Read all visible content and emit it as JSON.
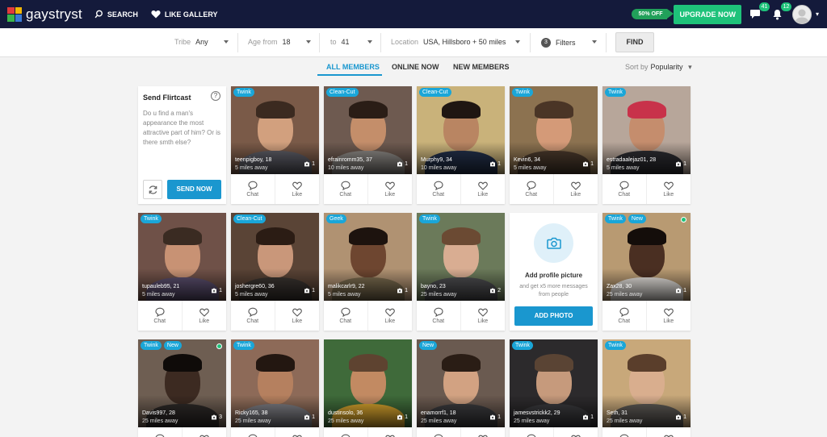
{
  "header": {
    "brand": "gaystryst",
    "nav": [
      {
        "label": "SEARCH",
        "icon": "search-icon"
      },
      {
        "label": "LIKE GALLERY",
        "icon": "heart-icon"
      }
    ],
    "discount": "50% OFF",
    "upgrade": "UPGRADE NOW",
    "messages_count": "41",
    "notifications_count": "12"
  },
  "filters": {
    "tribe_label": "Tribe",
    "tribe_value": "Any",
    "age_from_label": "Age from",
    "age_from_value": "18",
    "age_to_label": "to",
    "age_to_value": "41",
    "location_label": "Location",
    "location_value": "USA, Hillsboro + 50 miles",
    "filters_count": "3",
    "filters_label": "Filters",
    "find": "FIND"
  },
  "tabs": [
    {
      "label": "ALL MEMBERS",
      "active": true
    },
    {
      "label": "ONLINE NOW",
      "active": false
    },
    {
      "label": "NEW MEMBERS",
      "active": false
    }
  ],
  "sort": {
    "label": "Sort by",
    "value": "Popularity"
  },
  "flirtcast": {
    "title": "Send Flirtcast",
    "text": "Do u find a man's appearance the most attractive part of him? Or is there smth else?",
    "send": "SEND NOW",
    "help": "?"
  },
  "actions": {
    "chat": "Chat",
    "like": "Like"
  },
  "add_photo": {
    "title": "Add profile picture",
    "subtitle": "and get x5 more messages from people",
    "button": "ADD PHOTO"
  },
  "members": [
    {
      "name": "teenpigboy, 18",
      "distance": "5 miles away",
      "photos": "1",
      "badges": [
        "Twink"
      ],
      "online": false,
      "bg": "#7a5a48",
      "skin": "#d2a07e",
      "hair": "#3b2a20",
      "shirt": "#5d5d66"
    },
    {
      "name": "efrainromm35, 37",
      "distance": "10 miles away",
      "photos": "1",
      "badges": [
        "Clean-Cut"
      ],
      "online": false,
      "bg": "#6e5a50",
      "skin": "#c48e6a",
      "hair": "#2a1d16",
      "shirt": "#8e8a86"
    },
    {
      "name": "Murphy9, 34",
      "distance": "10 miles away",
      "photos": "1",
      "badges": [
        "Clean-Cut"
      ],
      "online": false,
      "bg": "#c9b27a",
      "skin": "#b98562",
      "hair": "#1f1612",
      "shirt": "#23304a"
    },
    {
      "name": "Kevin6, 34",
      "distance": "5 miles away",
      "photos": "1",
      "badges": [
        "Twink"
      ],
      "online": false,
      "bg": "#8c7250",
      "skin": "#d49a78",
      "hair": "#4a3526",
      "shirt": "#4b3a2c"
    },
    {
      "name": "estradaalejaz01, 28",
      "distance": "5 miles away",
      "photos": "1",
      "badges": [
        "Twink"
      ],
      "online": false,
      "bg": "#b7a69a",
      "skin": "#c58d6d",
      "hair": "#c8324a",
      "shirt": "#2d2d32"
    },
    {
      "name": "tupauleb95, 21",
      "distance": "5 miles away",
      "photos": "1",
      "badges": [
        "Twink"
      ],
      "online": false,
      "bg": "#6f5148",
      "skin": "#c89274",
      "hair": "#3a2b22",
      "shirt": "#5b4e6e"
    },
    {
      "name": "joshergre60, 36",
      "distance": "5 miles away",
      "photos": "1",
      "badges": [
        "Clean-Cut"
      ],
      "online": false,
      "bg": "#5a4436",
      "skin": "#c9977a",
      "hair": "#2b1c14",
      "shirt": "#3a3430"
    },
    {
      "name": "malikcarlr9, 22",
      "distance": "5 miles away",
      "photos": "1",
      "badges": [
        "Geek"
      ],
      "online": false,
      "bg": "#b09272",
      "skin": "#6e4630",
      "hair": "#1d130e",
      "shirt": "#7a6a4e"
    },
    {
      "name": "bayno, 23",
      "distance": "25 miles away",
      "photos": "2",
      "badges": [
        "Twink"
      ],
      "online": false,
      "bg": "#6b7a5a",
      "skin": "#d9ad92",
      "hair": "#6b4a33",
      "shirt": "#4d4d50"
    },
    {
      "name": "Zax28, 30",
      "distance": "25 miles away",
      "photos": "1",
      "badges": [
        "Twink",
        "New"
      ],
      "online": true,
      "bg": "#b89a72",
      "skin": "#4a2f22",
      "hair": "#140d0a",
      "shirt": "#e7e3de"
    },
    {
      "name": "Davis997, 28",
      "distance": "25 miles away",
      "photos": "3",
      "badges": [
        "Twink",
        "New"
      ],
      "online": true,
      "bg": "#6e5e52",
      "skin": "#3c2a21",
      "hair": "#0f0b09",
      "shirt": "#2e2a28"
    },
    {
      "name": "Ricky165, 38",
      "distance": "25 miles away",
      "photos": "1",
      "badges": [
        "Twink"
      ],
      "online": false,
      "bg": "#8d6a58",
      "skin": "#b5805f",
      "hair": "#231711",
      "shirt": "#7e7e84"
    },
    {
      "name": "dustinsolo, 36",
      "distance": "25 miles away",
      "photos": "1",
      "badges": [],
      "online": false,
      "bg": "#3f6a3a",
      "skin": "#c28a62",
      "hair": "#5e4330",
      "shirt": "#d9a52e"
    },
    {
      "name": "enamorrf1, 18",
      "distance": "25 miles away",
      "photos": "1",
      "badges": [
        "New"
      ],
      "online": false,
      "bg": "#6a5a50",
      "skin": "#d2a282",
      "hair": "#2a1d15",
      "shirt": "#3c3c3f"
    },
    {
      "name": "jamesvstrickk2, 29",
      "distance": "25 miles away",
      "photos": "1",
      "badges": [
        "Twink"
      ],
      "online": false,
      "bg": "#2c2a2c",
      "skin": "#c69a7c",
      "hair": "#5a4434",
      "shirt": "#3a3a3d"
    },
    {
      "name": "Seth, 31",
      "distance": "25 miles away",
      "photos": "1",
      "badges": [
        "Twink"
      ],
      "online": false,
      "bg": "#c8a87a",
      "skin": "#d9ae8e",
      "hair": "#5a3e2b",
      "shirt": "#5e5a56"
    }
  ]
}
